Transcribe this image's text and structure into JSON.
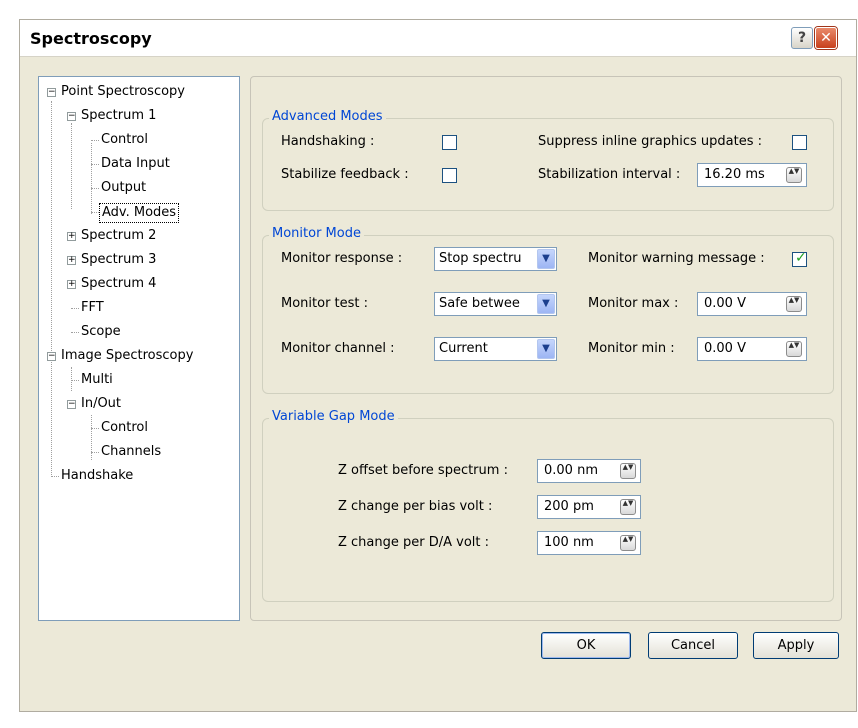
{
  "window": {
    "title": "Spectroscopy",
    "help_label": "?",
    "close_label": "✕"
  },
  "tree": {
    "point_spectroscopy": "Point Spectroscopy",
    "spectrum1": "Spectrum 1",
    "control": "Control",
    "data_input": "Data Input",
    "output": "Output",
    "adv_modes": "Adv. Modes",
    "spectrum2": "Spectrum 2",
    "spectrum3": "Spectrum 3",
    "spectrum4": "Spectrum 4",
    "fft": "FFT",
    "scope": "Scope",
    "image_spectroscopy": "Image Spectroscopy",
    "multi": "Multi",
    "in_out": "In/Out",
    "io_control": "Control",
    "channels": "Channels",
    "handshake": "Handshake",
    "expand_minus": "−",
    "expand_plus": "+"
  },
  "advanced_modes": {
    "title": "Advanced Modes",
    "handshaking_label": "Handshaking :",
    "handshaking_checked": false,
    "suppress_label": "Suppress inline graphics updates :",
    "suppress_checked": false,
    "stabilize_label": "Stabilize feedback :",
    "stabilize_checked": false,
    "interval_label": "Stabilization interval :",
    "interval_value": "16.20 ms"
  },
  "monitor_mode": {
    "title": "Monitor Mode",
    "response_label": "Monitor response :",
    "response_value": "Stop spectru",
    "warning_label": "Monitor warning message :",
    "warning_checked": true,
    "warning_mark": "✓",
    "test_label": "Monitor test :",
    "test_value": "Safe betwee",
    "max_label": "Monitor max :",
    "max_value": "0.00 V",
    "channel_label": "Monitor channel :",
    "channel_value": "Current",
    "min_label": "Monitor min :",
    "min_value": "0.00 V"
  },
  "variable_gap": {
    "title": "Variable Gap Mode",
    "z_offset_label": "Z offset before spectrum :",
    "z_offset_value": "0.00 nm",
    "z_bias_label": "Z change per bias volt :",
    "z_bias_value": "200 pm",
    "z_da_label": "Z change per D/A volt :",
    "z_da_value": "100 nm"
  },
  "buttons": {
    "ok": "OK",
    "cancel": "Cancel",
    "apply": "Apply"
  },
  "icons": {
    "spin": "▲▼",
    "dropdown": "▼"
  }
}
